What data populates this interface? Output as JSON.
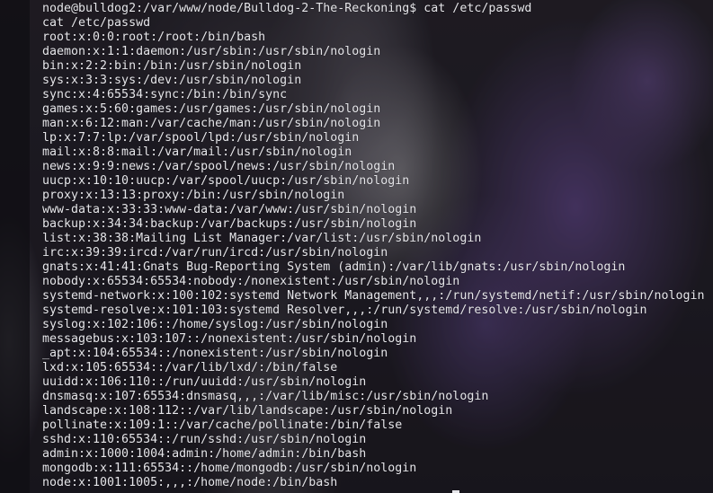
{
  "terminal": {
    "lines": [
      "node@bulldog2:/var/www/node/Bulldog-2-The-Reckoning$ cat /etc/passwd",
      "cat /etc/passwd",
      "root:x:0:0:root:/root:/bin/bash",
      "daemon:x:1:1:daemon:/usr/sbin:/usr/sbin/nologin",
      "bin:x:2:2:bin:/bin:/usr/sbin/nologin",
      "sys:x:3:3:sys:/dev:/usr/sbin/nologin",
      "sync:x:4:65534:sync:/bin:/bin/sync",
      "games:x:5:60:games:/usr/games:/usr/sbin/nologin",
      "man:x:6:12:man:/var/cache/man:/usr/sbin/nologin",
      "lp:x:7:7:lp:/var/spool/lpd:/usr/sbin/nologin",
      "mail:x:8:8:mail:/var/mail:/usr/sbin/nologin",
      "news:x:9:9:news:/var/spool/news:/usr/sbin/nologin",
      "uucp:x:10:10:uucp:/var/spool/uucp:/usr/sbin/nologin",
      "proxy:x:13:13:proxy:/bin:/usr/sbin/nologin",
      "www-data:x:33:33:www-data:/var/www:/usr/sbin/nologin",
      "backup:x:34:34:backup:/var/backups:/usr/sbin/nologin",
      "list:x:38:38:Mailing List Manager:/var/list:/usr/sbin/nologin",
      "irc:x:39:39:ircd:/var/run/ircd:/usr/sbin/nologin",
      "gnats:x:41:41:Gnats Bug-Reporting System (admin):/var/lib/gnats:/usr/sbin/nologin",
      "nobody:x:65534:65534:nobody:/nonexistent:/usr/sbin/nologin",
      "systemd-network:x:100:102:systemd Network Management,,,:/run/systemd/netif:/usr/sbin/nologin",
      "systemd-resolve:x:101:103:systemd Resolver,,,:/run/systemd/resolve:/usr/sbin/nologin",
      "syslog:x:102:106::/home/syslog:/usr/sbin/nologin",
      "messagebus:x:103:107::/nonexistent:/usr/sbin/nologin",
      "_apt:x:104:65534::/nonexistent:/usr/sbin/nologin",
      "lxd:x:105:65534::/var/lib/lxd/:/bin/false",
      "uuidd:x:106:110::/run/uuidd:/usr/sbin/nologin",
      "dnsmasq:x:107:65534:dnsmasq,,,:/var/lib/misc:/usr/sbin/nologin",
      "landscape:x:108:112::/var/lib/landscape:/usr/sbin/nologin",
      "pollinate:x:109:1::/var/cache/pollinate:/bin/false",
      "sshd:x:110:65534::/run/sshd:/usr/sbin/nologin",
      "admin:x:1000:1004:admin:/home/admin:/bin/bash",
      "mongodb:x:111:65534::/home/mongodb:/usr/sbin/nologin",
      "node:x:1001:1005:,,,:/home/node:/bin/bash"
    ]
  },
  "colors": {
    "text": "#e6e6ea",
    "terminal_background": "#19181f",
    "wallpaper_accent": "#7052a0"
  }
}
